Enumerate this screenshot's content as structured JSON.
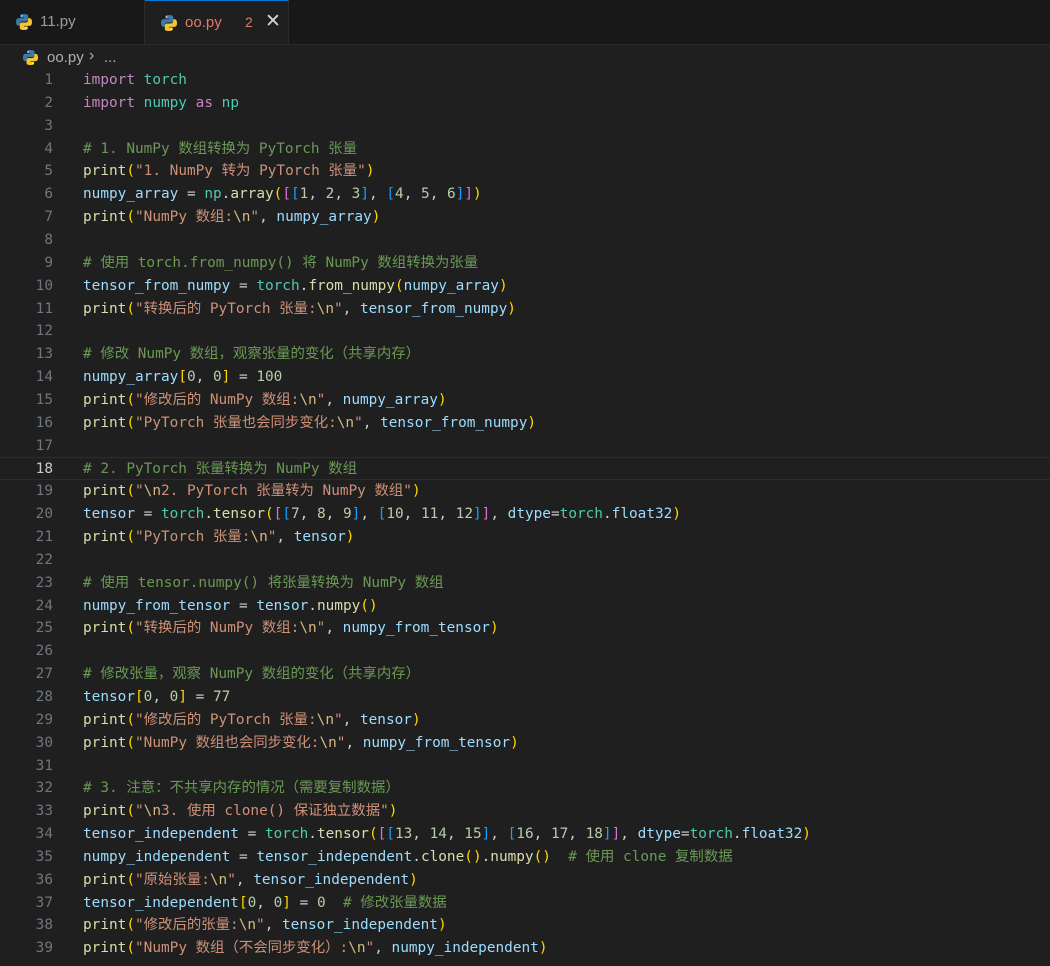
{
  "tabs": [
    {
      "label": "11.py",
      "active": false
    },
    {
      "label": "oo.py",
      "active": true,
      "badge": "2",
      "close_glyph": "✕"
    }
  ],
  "breadcrumb": {
    "file": "oo.py",
    "separator": "›",
    "more": "..."
  },
  "editor": {
    "language": "python",
    "current_line": 18,
    "lines": [
      "import torch",
      "import numpy as np",
      "",
      "# 1. NumPy 数组转换为 PyTorch 张量",
      "print(\"1. NumPy 转为 PyTorch 张量\")",
      "numpy_array = np.array([[1, 2, 3], [4, 5, 6]])",
      "print(\"NumPy 数组:\\n\", numpy_array)",
      "",
      "# 使用 torch.from_numpy() 将 NumPy 数组转换为张量",
      "tensor_from_numpy = torch.from_numpy(numpy_array)",
      "print(\"转换后的 PyTorch 张量:\\n\", tensor_from_numpy)",
      "",
      "# 修改 NumPy 数组，观察张量的变化（共享内存）",
      "numpy_array[0, 0] = 100",
      "print(\"修改后的 NumPy 数组:\\n\", numpy_array)",
      "print(\"PyTorch 张量也会同步变化:\\n\", tensor_from_numpy)",
      "",
      "# 2. PyTorch 张量转换为 NumPy 数组",
      "print(\"\\n2. PyTorch 张量转为 NumPy 数组\")",
      "tensor = torch.tensor([[7, 8, 9], [10, 11, 12]], dtype=torch.float32)",
      "print(\"PyTorch 张量:\\n\", tensor)",
      "",
      "# 使用 tensor.numpy() 将张量转换为 NumPy 数组",
      "numpy_from_tensor = tensor.numpy()",
      "print(\"转换后的 NumPy 数组:\\n\", numpy_from_tensor)",
      "",
      "# 修改张量，观察 NumPy 数组的变化（共享内存）",
      "tensor[0, 0] = 77",
      "print(\"修改后的 PyTorch 张量:\\n\", tensor)",
      "print(\"NumPy 数组也会同步变化:\\n\", numpy_from_tensor)",
      "",
      "# 3. 注意：不共享内存的情况（需要复制数据）",
      "print(\"\\n3. 使用 clone() 保证独立数据\")",
      "tensor_independent = torch.tensor([[13, 14, 15], [16, 17, 18]], dtype=torch.float32)",
      "numpy_independent = tensor_independent.clone().numpy()  # 使用 clone 复制数据",
      "print(\"原始张量:\\n\", tensor_independent)",
      "tensor_independent[0, 0] = 0  # 修改张量数据",
      "print(\"修改后的张量:\\n\", tensor_independent)",
      "print(\"NumPy 数组（不会同步变化）:\\n\", numpy_independent)"
    ]
  },
  "colors": {
    "background": "#1f1f1f",
    "tab_active_accent": "#0078d4",
    "modified_text": "#e2796b",
    "keyword": "#c586c0",
    "module": "#4ec9b0",
    "function": "#dcdcaa",
    "string": "#ce9178",
    "number": "#b5cea8",
    "variable": "#9cdcfe",
    "comment": "#6a9955"
  },
  "icons": [
    "python-file-icon",
    "close-icon",
    "chevron-right-icon"
  ]
}
